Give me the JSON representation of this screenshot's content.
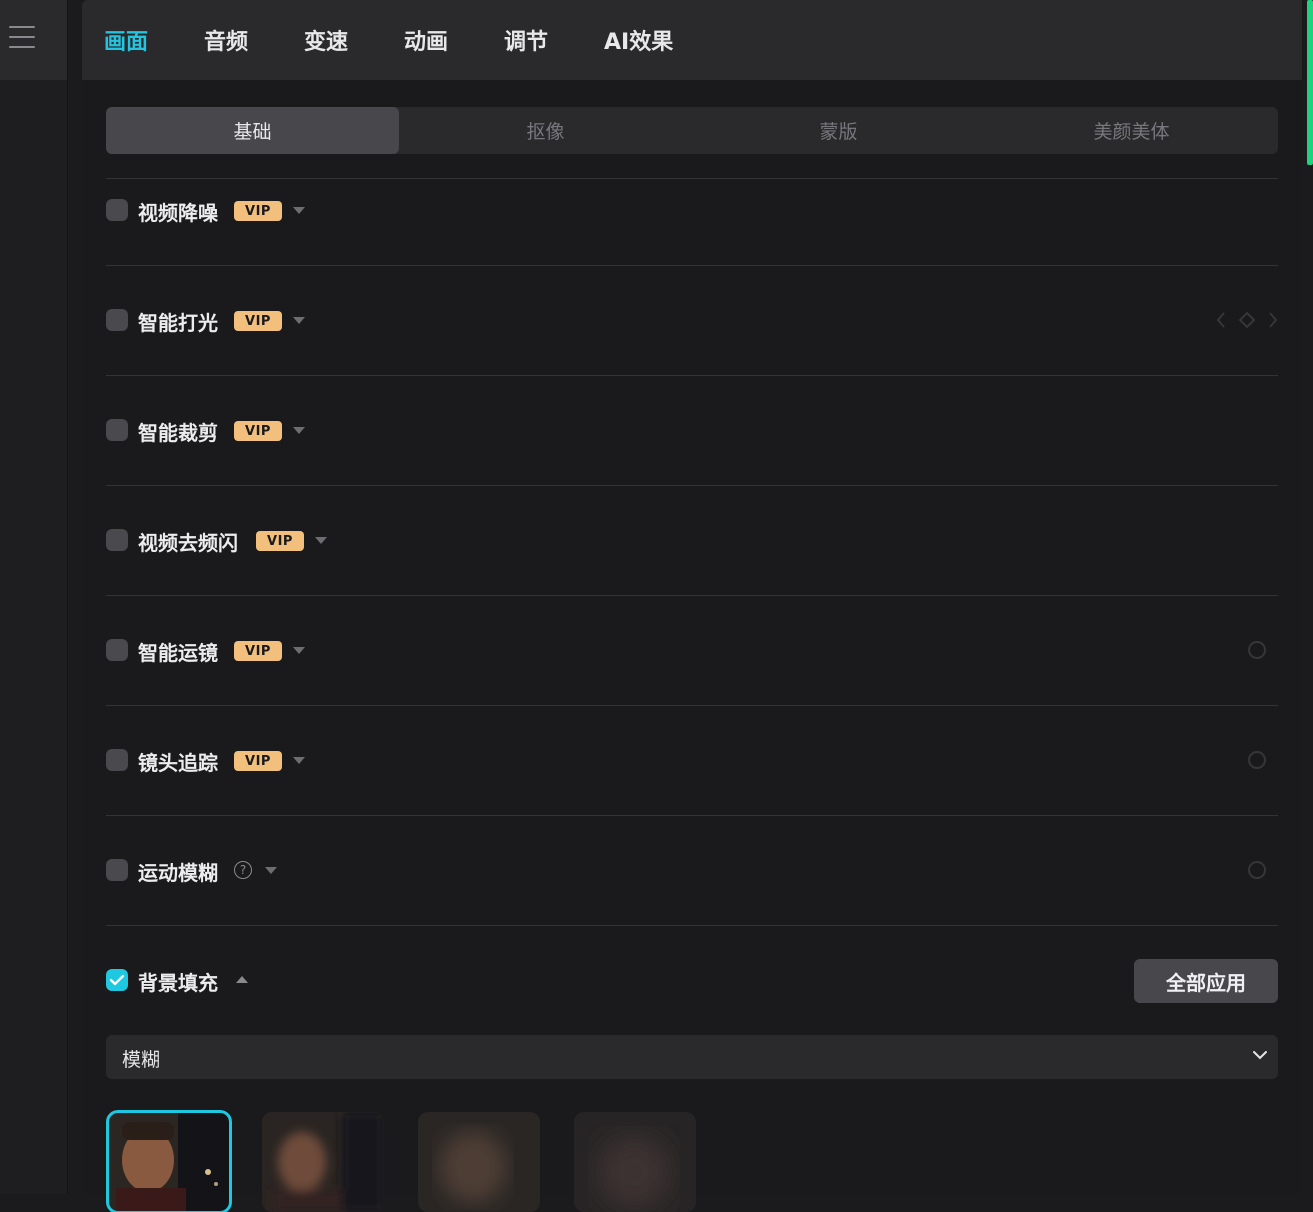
{
  "top_tabs": [
    {
      "label": "画面",
      "active": true
    },
    {
      "label": "音频"
    },
    {
      "label": "变速"
    },
    {
      "label": "动画"
    },
    {
      "label": "调节"
    },
    {
      "label": "AI效果"
    }
  ],
  "sub_tabs": [
    {
      "label": "基础",
      "active": true
    },
    {
      "label": "抠像"
    },
    {
      "label": "蒙版"
    },
    {
      "label": "美颜美体"
    }
  ],
  "vip_badge": "VIP",
  "features": [
    {
      "label": "视频降噪",
      "checked": false,
      "vip": true
    },
    {
      "label": "智能打光",
      "checked": false,
      "vip": true
    },
    {
      "label": "智能裁剪",
      "checked": false,
      "vip": true
    },
    {
      "label": "视频去频闪",
      "checked": false,
      "vip": true
    },
    {
      "label": "智能运镜",
      "checked": false,
      "vip": true
    },
    {
      "label": "镜头追踪",
      "checked": false,
      "vip": true
    },
    {
      "label": "运动模糊",
      "checked": false,
      "vip": false,
      "help_icon": "question-circle-icon"
    },
    {
      "label": "背景填充",
      "checked": true,
      "vip": false,
      "expanded": true
    }
  ],
  "background_fill": {
    "apply_all_label": "全部应用",
    "select_value": "模糊",
    "thumbnails": [
      {
        "name": "blur-none",
        "selected": true
      },
      {
        "name": "blur-light",
        "selected": false
      },
      {
        "name": "blur-medium",
        "selected": false
      },
      {
        "name": "blur-heavy",
        "selected": false
      }
    ]
  },
  "colors": {
    "accent": "#22c4e0",
    "vip": "#f2c07c",
    "scroll_accent": "#1fd27e",
    "panel_bg": "#1a1a1c",
    "tabbar_bg": "#2a2a2d"
  }
}
